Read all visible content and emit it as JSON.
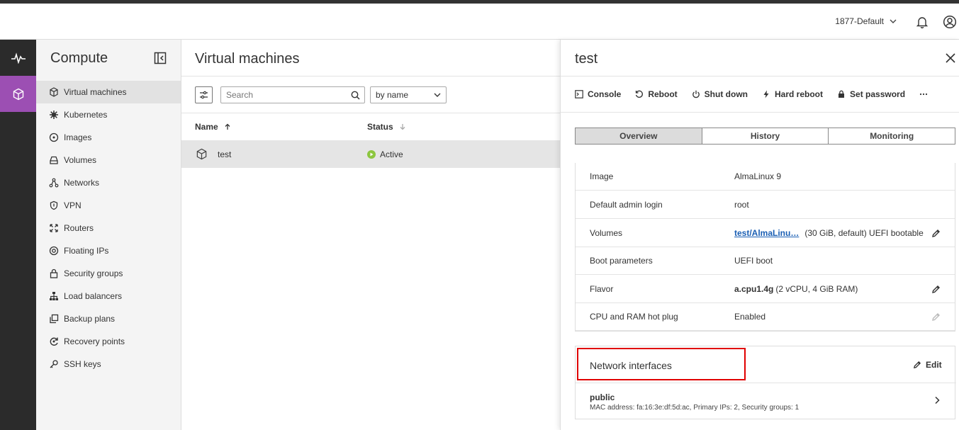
{
  "header": {
    "project": "1877-Default"
  },
  "rail": {
    "items": [
      {
        "icon": "activity-icon"
      },
      {
        "icon": "cube-icon",
        "active": true
      }
    ]
  },
  "sidebar": {
    "title": "Compute",
    "items": [
      {
        "label": "Virtual machines",
        "icon": "cube-icon",
        "active": true
      },
      {
        "label": "Kubernetes",
        "icon": "kubernetes-icon"
      },
      {
        "label": "Images",
        "icon": "disc-icon"
      },
      {
        "label": "Volumes",
        "icon": "drive-icon"
      },
      {
        "label": "Networks",
        "icon": "network-icon"
      },
      {
        "label": "VPN",
        "icon": "shield-icon"
      },
      {
        "label": "Routers",
        "icon": "router-icon"
      },
      {
        "label": "Floating IPs",
        "icon": "floating-ip-icon"
      },
      {
        "label": "Security groups",
        "icon": "lock-icon"
      },
      {
        "label": "Load balancers",
        "icon": "load-balancer-icon"
      },
      {
        "label": "Backup plans",
        "icon": "backup-icon"
      },
      {
        "label": "Recovery points",
        "icon": "recovery-icon"
      },
      {
        "label": "SSH keys",
        "icon": "key-icon"
      }
    ]
  },
  "main": {
    "title": "Virtual machines",
    "search_placeholder": "Search",
    "sort_value": "by name",
    "columns": {
      "name": "Name",
      "status": "Status"
    },
    "rows": [
      {
        "name": "test",
        "status": "Active"
      }
    ]
  },
  "panel": {
    "title": "test",
    "actions": {
      "console": "Console",
      "reboot": "Reboot",
      "shutdown": "Shut down",
      "hard_reboot": "Hard reboot",
      "set_password": "Set password"
    },
    "tabs": [
      "Overview",
      "History",
      "Monitoring"
    ],
    "properties": {
      "image_label": "Image",
      "image_value": "AlmaLinux 9",
      "admin_label": "Default admin login",
      "admin_value": "root",
      "volumes_label": "Volumes",
      "volumes_link": "test/AlmaLinu…",
      "volumes_detail": "(30 GiB, default) UEFI bootable",
      "boot_label": "Boot parameters",
      "boot_value": "UEFI boot",
      "flavor_label": "Flavor",
      "flavor_name": "a.cpu1.4g",
      "flavor_detail": "(2 vCPU, 4 GiB RAM)",
      "hotplug_label": "CPU and RAM hot plug",
      "hotplug_value": "Enabled"
    },
    "network": {
      "title": "Network interfaces",
      "edit": "Edit",
      "interface_name": "public",
      "interface_detail": "MAC address: fa:16:3e:df:5d:ac, Primary IPs: 2, Security groups: 1"
    }
  },
  "colors": {
    "accent": "#9c4fb3",
    "active_status": "#8cc63f",
    "highlight": "#e00000",
    "link": "#1a5fb4"
  }
}
